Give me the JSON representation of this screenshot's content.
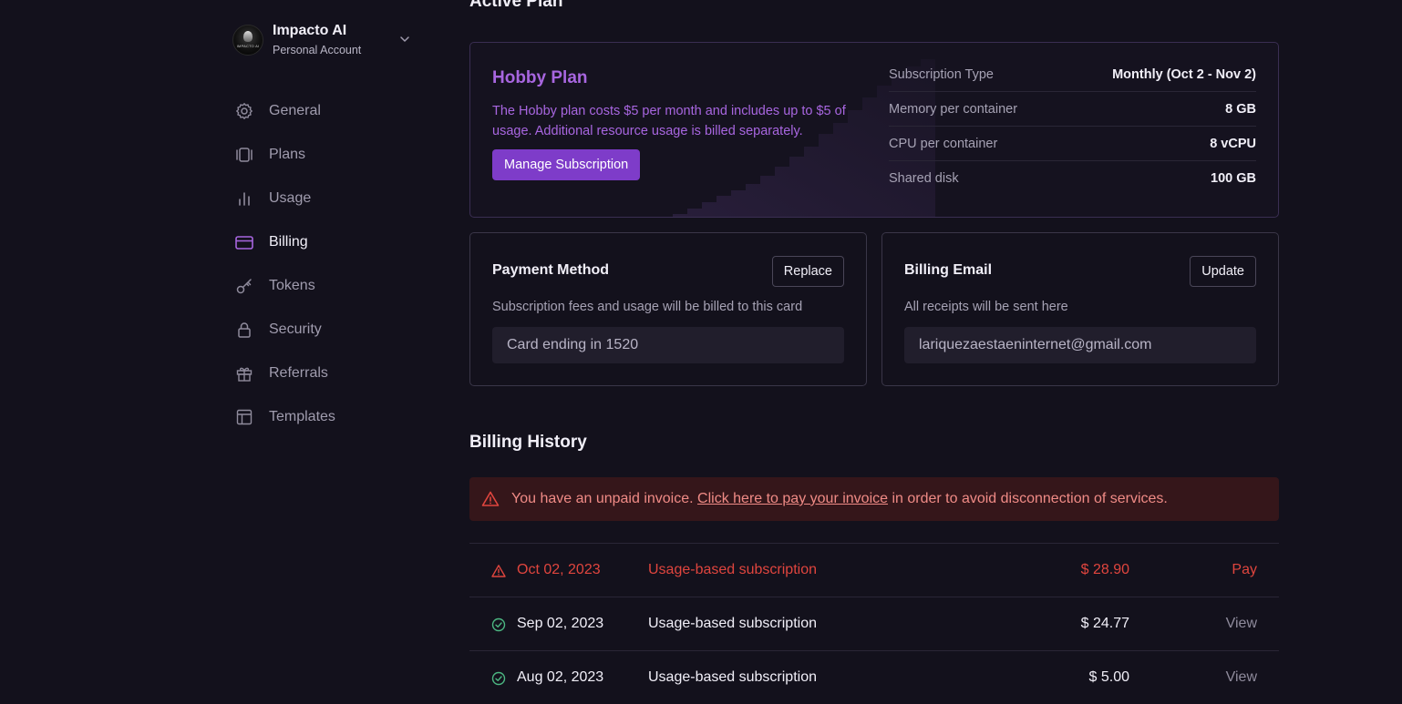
{
  "account": {
    "name": "Impacto AI",
    "type": "Personal Account",
    "logo_text": "IMPACTO AI"
  },
  "sidebar": {
    "items": [
      {
        "label": "General",
        "icon": "gear-icon"
      },
      {
        "label": "Plans",
        "icon": "plans-icon"
      },
      {
        "label": "Usage",
        "icon": "bar-chart-icon"
      },
      {
        "label": "Billing",
        "icon": "credit-card-icon",
        "active": true
      },
      {
        "label": "Tokens",
        "icon": "key-icon"
      },
      {
        "label": "Security",
        "icon": "lock-icon"
      },
      {
        "label": "Referrals",
        "icon": "gift-icon"
      },
      {
        "label": "Templates",
        "icon": "template-icon"
      }
    ]
  },
  "main": {
    "active_plan_heading": "Active Plan",
    "plan": {
      "title": "Hobby Plan",
      "description": "The Hobby plan costs $5 per month and includes up to $5 of usage. Additional resource usage is billed separately.",
      "manage_label": "Manage Subscription",
      "specs": [
        {
          "key": "Subscription Type",
          "value": "Monthly (Oct 2 - Nov 2)"
        },
        {
          "key": "Memory per container",
          "value": "8 GB"
        },
        {
          "key": "CPU per container",
          "value": "8 vCPU"
        },
        {
          "key": "Shared disk",
          "value": "100 GB"
        }
      ]
    },
    "payment": {
      "title": "Payment Method",
      "button": "Replace",
      "subtitle": "Subscription fees and usage will be billed to this card",
      "value": "Card ending in 1520"
    },
    "billing_email": {
      "title": "Billing Email",
      "button": "Update",
      "subtitle": "All receipts will be sent here",
      "value": "lariquezaestaeninternet@gmail.com"
    },
    "history": {
      "title": "Billing History",
      "alert": {
        "prefix": "You have an unpaid invoice.",
        "link": "Click here to pay your invoice",
        "suffix": "in order to avoid disconnection of services."
      },
      "rows": [
        {
          "date": "Oct 02, 2023",
          "description": "Usage-based subscription",
          "amount": "$ 28.90",
          "action": "Pay",
          "status": "unpaid"
        },
        {
          "date": "Sep 02, 2023",
          "description": "Usage-based subscription",
          "amount": "$ 24.77",
          "action": "View",
          "status": "paid"
        },
        {
          "date": "Aug 02, 2023",
          "description": "Usage-based subscription",
          "amount": "$ 5.00",
          "action": "View",
          "status": "paid"
        }
      ]
    }
  },
  "colors": {
    "accent": "#a866e0",
    "button": "#7e3cc9",
    "danger": "#e0453e",
    "success": "#4cb782"
  }
}
